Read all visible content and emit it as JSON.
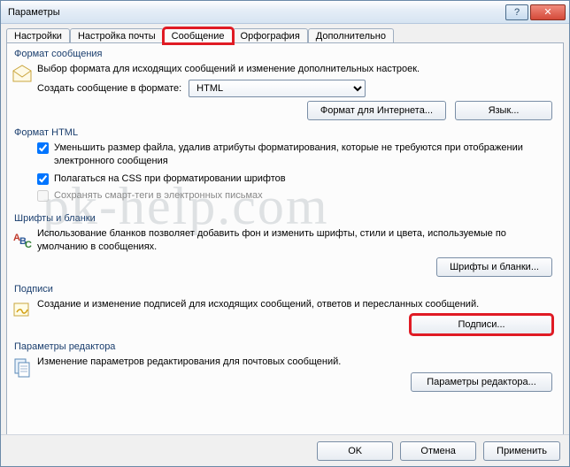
{
  "window": {
    "title": "Параметры"
  },
  "tabs": {
    "items": [
      {
        "label": "Настройки"
      },
      {
        "label": "Настройка почты"
      },
      {
        "label": "Сообщение"
      },
      {
        "label": "Орфография"
      },
      {
        "label": "Дополнительно"
      }
    ],
    "active": 2
  },
  "groups": {
    "format": {
      "title": "Формат сообщения",
      "desc": "Выбор формата для исходящих сообщений и изменение дополнительных настроек.",
      "compose_label": "Создать сообщение в формате:",
      "compose_value": "HTML",
      "btn_internet": "Формат для Интернета...",
      "btn_lang": "Язык..."
    },
    "html": {
      "title": "Формат HTML",
      "chk1": "Уменьшить размер файла, удалив атрибуты форматирования, которые не требуются при отображении электронного сообщения",
      "chk2": "Полагаться на CSS при форматировании шрифтов",
      "chk3": "Сохранять смарт-теги в электронных письмах"
    },
    "fonts": {
      "title": "Шрифты и бланки",
      "desc": "Использование бланков позволяет добавить фон и изменить шрифты, стили и цвета, используемые по умолчанию в сообщениях.",
      "btn": "Шрифты и бланки..."
    },
    "sign": {
      "title": "Подписи",
      "desc": "Создание и изменение подписей для исходящих сообщений, ответов и пересланных сообщений.",
      "btn": "Подписи..."
    },
    "editor": {
      "title": "Параметры редактора",
      "desc": "Изменение параметров редактирования для почтовых сообщений.",
      "btn": "Параметры редактора..."
    }
  },
  "footer": {
    "ok": "OK",
    "cancel": "Отмена",
    "apply": "Применить"
  },
  "watermark": "pk-help.com"
}
